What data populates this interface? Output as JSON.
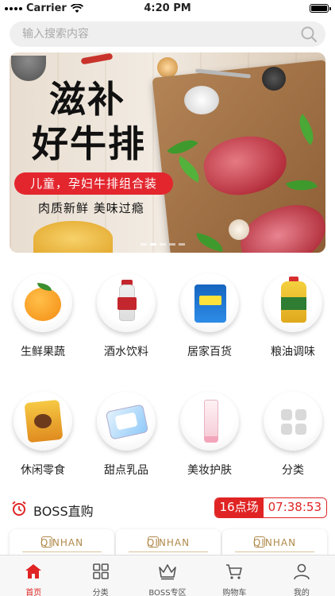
{
  "status_bar": {
    "carrier": "Carrier",
    "time": "4:20 PM"
  },
  "search": {
    "placeholder": "输入搜索内容"
  },
  "banner": {
    "title_line1": "滋补",
    "title_line2": "好牛排",
    "tag": "儿童，孕妇牛排组合装",
    "subtitle": "肉质新鲜 美味过瘾"
  },
  "categories": [
    {
      "label": "生鲜果蔬",
      "icon": "orange-icon"
    },
    {
      "label": "酒水饮料",
      "icon": "liquor-bottle-icon"
    },
    {
      "label": "居家百货",
      "icon": "detergent-icon"
    },
    {
      "label": "粮油调味",
      "icon": "cooking-oil-icon"
    },
    {
      "label": "休闲零食",
      "icon": "snack-icon"
    },
    {
      "label": "甜点乳品",
      "icon": "dessert-icon"
    },
    {
      "label": "美妆护肤",
      "icon": "skincare-icon"
    },
    {
      "label": "分类",
      "icon": "grid-icon"
    }
  ],
  "boss": {
    "title": "BOSS直购",
    "slot": "16点场",
    "countdown": "07:38:53",
    "products": [
      {
        "brand": "QINHAN"
      },
      {
        "brand": "QINHAN"
      },
      {
        "brand": "QINHAN"
      }
    ]
  },
  "tab_bar": {
    "tabs": [
      {
        "label": "首页",
        "icon": "home-icon",
        "active": true
      },
      {
        "label": "分类",
        "icon": "category-grid-icon",
        "active": false
      },
      {
        "label": "BOSS专区",
        "icon": "crown-icon",
        "active": false
      },
      {
        "label": "购物车",
        "icon": "cart-icon",
        "active": false
      },
      {
        "label": "我的",
        "icon": "user-icon",
        "active": false
      }
    ]
  },
  "colors": {
    "accent": "#e02424",
    "tab_inactive": "#555555",
    "search_bg": "#efefef"
  }
}
